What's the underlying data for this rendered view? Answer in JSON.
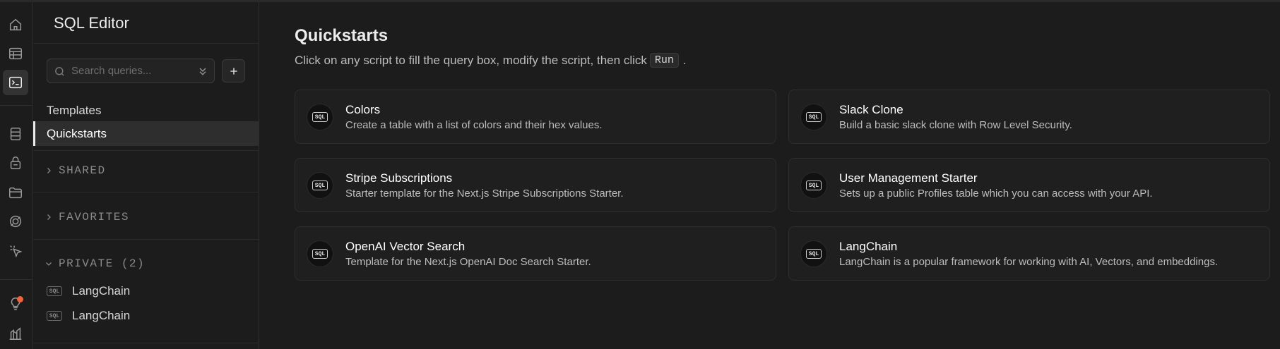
{
  "colors": {
    "accent_notification": "#f0643c",
    "background": "#1c1c1c"
  },
  "rail": {
    "icons": [
      "home-icon",
      "table-editor-icon",
      "sql-editor-icon",
      "database-icon",
      "auth-icon",
      "storage-icon",
      "realtime-icon",
      "edge-functions-icon",
      "advisors-icon",
      "reports-icon"
    ]
  },
  "sidebar": {
    "title": "SQL Editor",
    "search_placeholder": "Search queries...",
    "nav": {
      "templates": "Templates",
      "quickstarts": "Quickstarts"
    },
    "sections": {
      "shared": "SHARED",
      "favorites": "FAVORITES",
      "private": "PRIVATE (2)"
    },
    "private_queries": [
      {
        "badge": "SQL",
        "label": "LangChain"
      },
      {
        "badge": "SQL",
        "label": "LangChain"
      }
    ]
  },
  "main": {
    "title": "Quickstarts",
    "desc_before": "Click on any script to fill the query box, modify the script, then click",
    "run_label": "Run",
    "desc_after": ".",
    "cards": [
      {
        "badge": "SQL",
        "title": "Colors",
        "desc": "Create a table with a list of colors and their hex values."
      },
      {
        "badge": "SQL",
        "title": "Slack Clone",
        "desc": "Build a basic slack clone with Row Level Security."
      },
      {
        "badge": "SQL",
        "title": "Stripe Subscriptions",
        "desc": "Starter template for the Next.js Stripe Subscriptions Starter."
      },
      {
        "badge": "SQL",
        "title": "User Management Starter",
        "desc": "Sets up a public Profiles table which you can access with your API."
      },
      {
        "badge": "SQL",
        "title": "OpenAI Vector Search",
        "desc": "Template for the Next.js OpenAI Doc Search Starter."
      },
      {
        "badge": "SQL",
        "title": "LangChain",
        "desc": "LangChain is a popular framework for working with AI, Vectors, and embeddings."
      }
    ]
  }
}
